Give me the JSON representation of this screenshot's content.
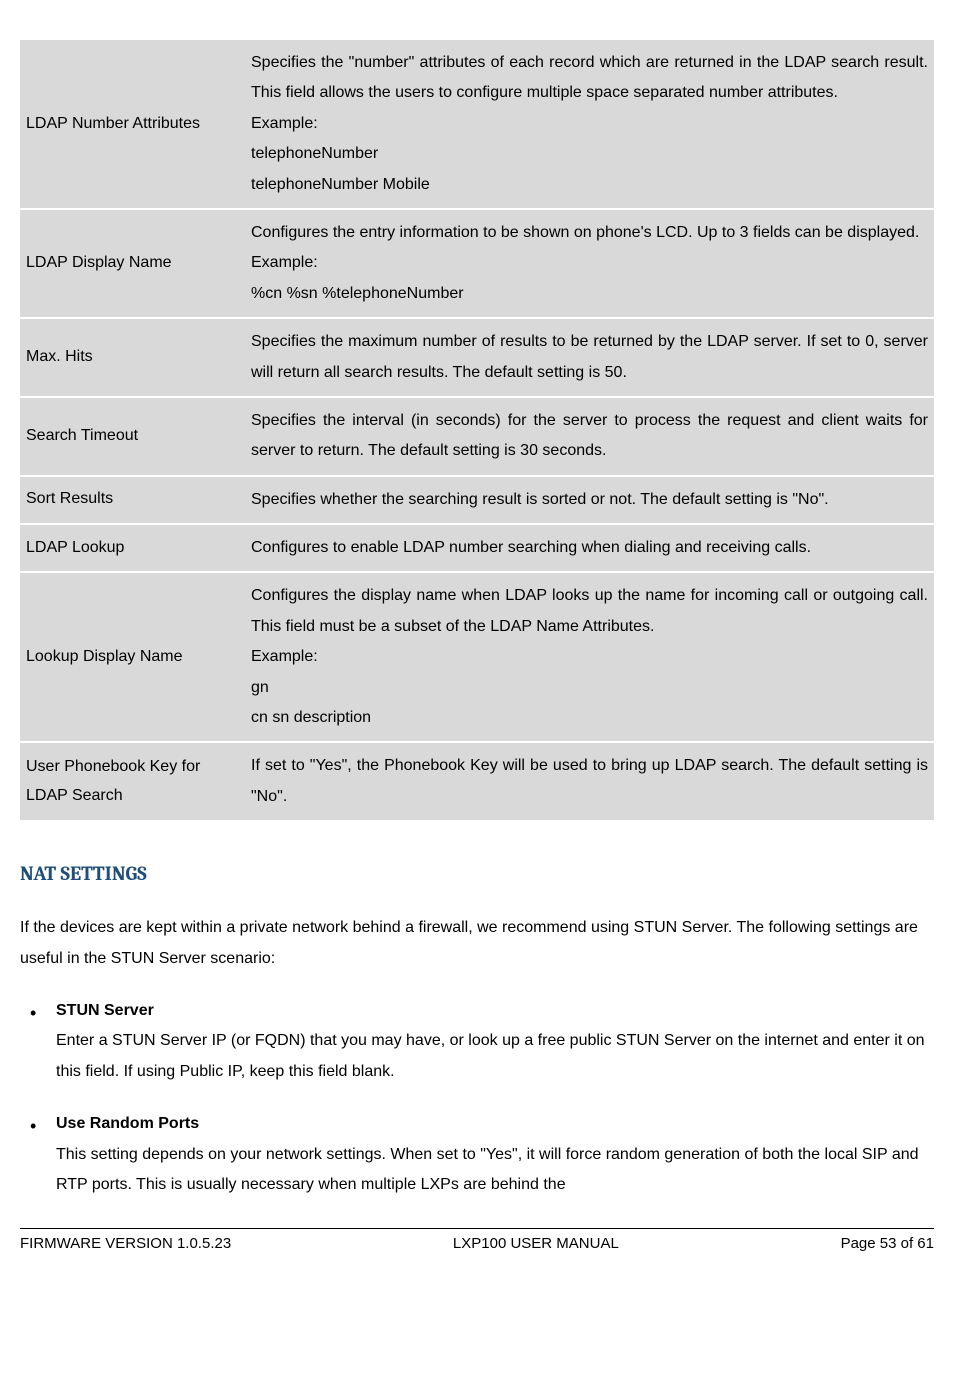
{
  "rows": [
    {
      "label": "LDAP Number Attributes",
      "desc": "Specifies the \"number\" attributes of each record which are returned in the LDAP search result. This field allows the users to configure multiple space separated number attributes.\nExample:\ntelephoneNumber\ntelephoneNumber Mobile"
    },
    {
      "label": "LDAP Display Name",
      "desc": "Configures the entry information to be shown on phone's LCD. Up to 3 fields can be displayed.\nExample:\n%cn %sn %telephoneNumber"
    },
    {
      "label": "Max. Hits",
      "desc": "Specifies the maximum number of results to be returned by the LDAP server. If set to 0, server will return all search results. The default setting is 50."
    },
    {
      "label": "Search Timeout",
      "desc": "Specifies the interval (in seconds) for the server to process the request and client waits for server to return. The default setting is 30 seconds."
    },
    {
      "label": "Sort Results",
      "desc": "Specifies whether the searching result is sorted or not. The default setting is \"No\"."
    },
    {
      "label": "LDAP Lookup",
      "desc": "Configures to enable LDAP number searching when dialing and receiving calls."
    },
    {
      "label": "Lookup Display Name",
      "desc": "Configures the display name when LDAP looks up the name for incoming call or outgoing call. This field must be a subset of the LDAP Name Attributes.\nExample:\ngn\ncn sn description"
    },
    {
      "label": "User Phonebook Key for LDAP Search",
      "desc": "If set to \"Yes\", the Phonebook Key will be used to bring up LDAP search. The default setting is \"No\"."
    }
  ],
  "section": {
    "heading": "NAT SETTINGS",
    "intro": "If the devices are kept within a private network behind a firewall, we recommend using STUN Server. The following settings are useful in the STUN Server scenario:",
    "bullets": [
      {
        "title": "STUN Server",
        "body": "Enter a STUN Server IP (or FQDN) that you may have, or look up a free public STUN Server on the internet and enter it on this field. If using Public IP, keep this field blank."
      },
      {
        "title": "Use Random Ports",
        "body": "This setting depends on your network settings. When set to \"Yes\", it will force random generation of both the local SIP and RTP ports. This is usually necessary when multiple LXPs are behind the"
      }
    ]
  },
  "footer": {
    "left": "FIRMWARE VERSION 1.0.5.23",
    "center": "LXP100 USER MANUAL",
    "right": "Page 53 of 61"
  }
}
